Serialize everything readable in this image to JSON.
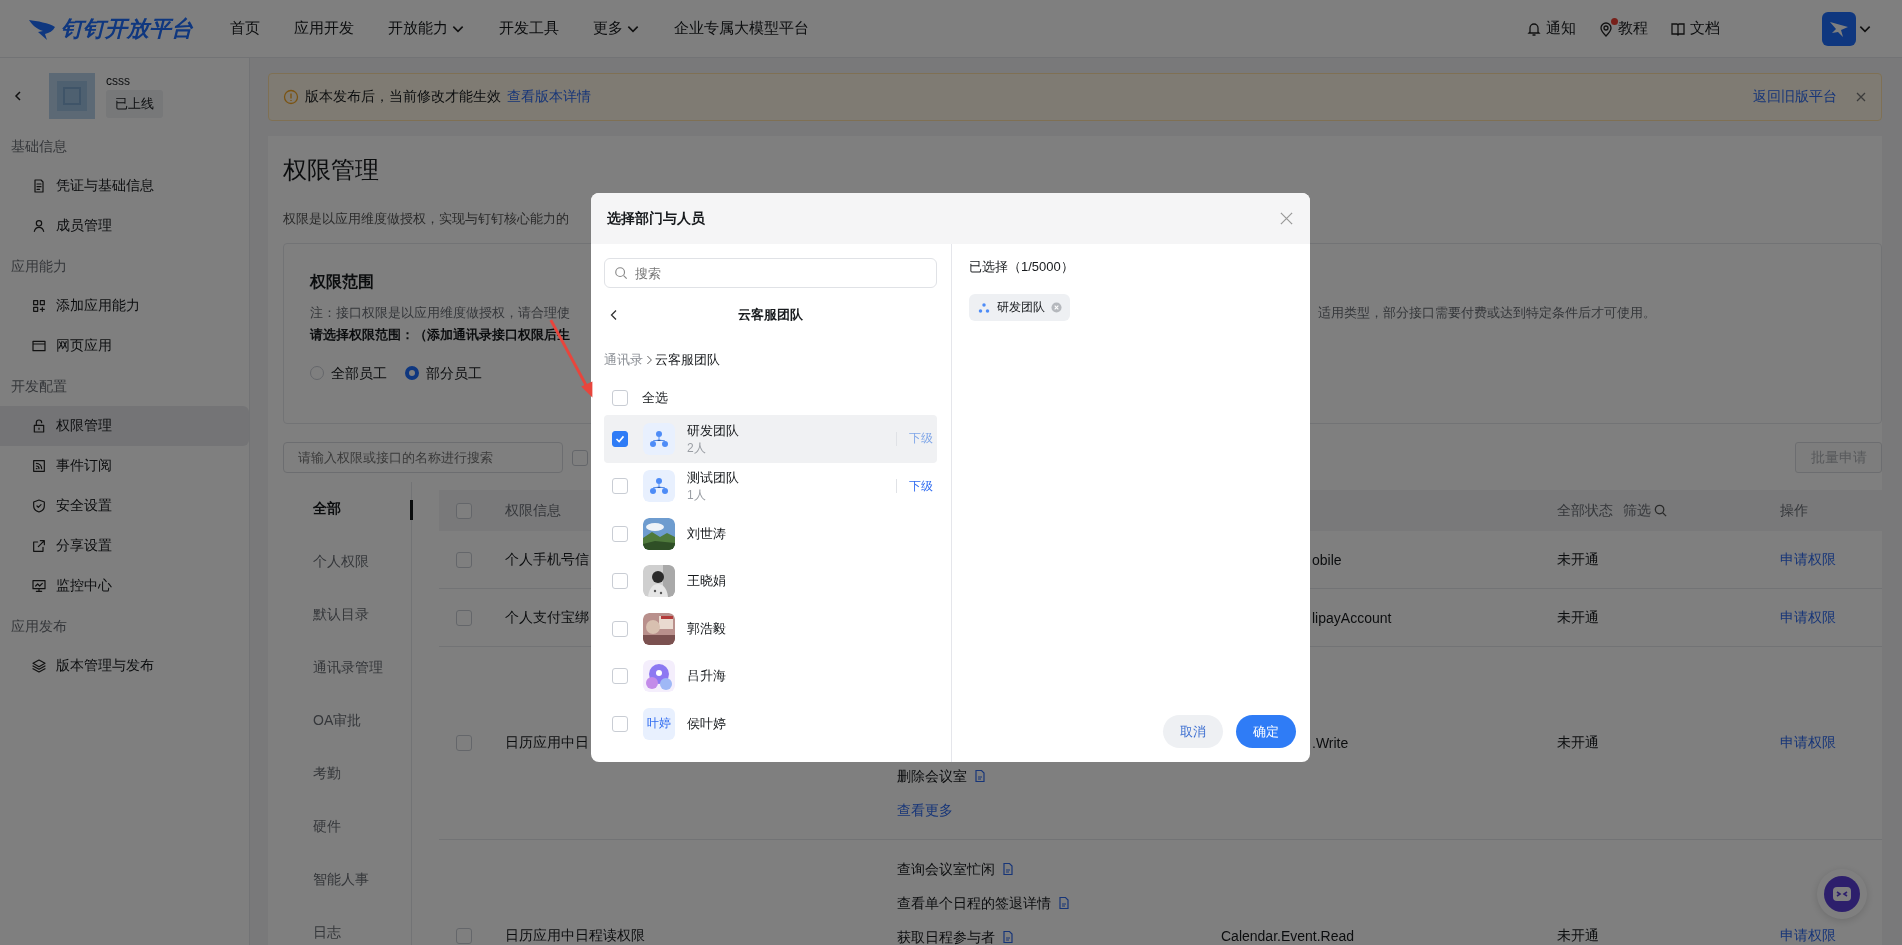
{
  "nav": {
    "logo": "钉钉开放平台",
    "menu": [
      {
        "label": "首页",
        "dropdown": false
      },
      {
        "label": "应用开发",
        "dropdown": false
      },
      {
        "label": "开放能力",
        "dropdown": true
      },
      {
        "label": "开发工具",
        "dropdown": false
      },
      {
        "label": "更多",
        "dropdown": true
      },
      {
        "label": "企业专属大模型平台",
        "dropdown": false
      }
    ],
    "links": [
      {
        "label": "通知",
        "badge": false
      },
      {
        "label": "教程",
        "badge": true
      },
      {
        "label": "文档",
        "badge": false
      }
    ]
  },
  "app": {
    "name": "csss",
    "status": "已上线"
  },
  "sidebar": [
    {
      "title": "基础信息",
      "items": [
        {
          "label": "凭证与基础信息",
          "selected": false
        },
        {
          "label": "成员管理",
          "selected": false
        }
      ]
    },
    {
      "title": "应用能力",
      "items": [
        {
          "label": "添加应用能力",
          "selected": false
        },
        {
          "label": "网页应用",
          "selected": false
        }
      ]
    },
    {
      "title": "开发配置",
      "items": [
        {
          "label": "权限管理",
          "selected": true
        },
        {
          "label": "事件订阅",
          "selected": false
        },
        {
          "label": "安全设置",
          "selected": false
        },
        {
          "label": "分享设置",
          "selected": false
        },
        {
          "label": "监控中心",
          "selected": false
        }
      ]
    },
    {
      "title": "应用发布",
      "items": [
        {
          "label": "版本管理与发布",
          "selected": false
        }
      ]
    }
  ],
  "banner": {
    "text": "版本发布后，当前修改才能生效",
    "link": "查看版本详情",
    "back_link": "返回旧版平台"
  },
  "page": {
    "title": "权限管理",
    "description": "权限是以应用维度做授权，实现与钉钉核心能力的"
  },
  "scope": {
    "title": "权限范围",
    "note_left": "注：接口权限是以应用维度做授权，请合理使",
    "note_right": "适用类型，部分接口需要付费或达到特定条件后才可使用。",
    "prompt": "请选择权限范围：（添加通讯录接口权限后生",
    "options": [
      {
        "label": "全部员工",
        "selected": false
      },
      {
        "label": "部分员工",
        "selected": true
      }
    ]
  },
  "search": {
    "placeholder": "请输入权限或接口的名称进行搜索"
  },
  "filter_checkbox": {
    "checked": false
  },
  "batch_button": "批量申请",
  "categories": [
    {
      "label": "全部",
      "selected": true
    },
    {
      "label": "个人权限",
      "selected": false
    },
    {
      "label": "默认目录",
      "selected": false
    },
    {
      "label": "通讯录管理",
      "selected": false
    },
    {
      "label": "OA审批",
      "selected": false
    },
    {
      "label": "考勤",
      "selected": false
    },
    {
      "label": "硬件",
      "selected": false
    },
    {
      "label": "智能人事",
      "selected": false
    },
    {
      "label": "日志",
      "selected": false
    }
  ],
  "table": {
    "columns": {
      "info": "权限信息",
      "status": "全部状态",
      "filter": "筛选",
      "action": "操作"
    },
    "header_checked": false,
    "rows": [
      {
        "checked": false,
        "info": "个人手机号信",
        "under_dialog": true,
        "api": "obile",
        "status": "未开通",
        "action": "申请权限"
      },
      {
        "checked": false,
        "info": "个人支付宝绑",
        "under_dialog": true,
        "api": "lipayAccount",
        "status": "未开通",
        "action": "申请权限"
      },
      {
        "checked": false,
        "info": "日历应用中日",
        "under_dialog": true,
        "names": [
          "删除会议室"
        ],
        "more": "查看更多",
        "api": ".Write",
        "status": "未开通",
        "action": "申请权限"
      },
      {
        "checked": false,
        "info": "日历应用中日程读权限",
        "names": [
          "查询会议室忙闲",
          "查看单个日程的签退详情",
          "获取日程参与者"
        ],
        "api": "Calendar.Event.Read",
        "status": "未开通",
        "action": "申请权限"
      }
    ]
  },
  "dialog": {
    "title": "选择部门与人员",
    "search_placeholder": "搜索",
    "folder": "云客服团队",
    "breadcrumb": [
      "通讯录",
      "云客服团队"
    ],
    "select_all": {
      "label": "全选",
      "checked": false
    },
    "items": [
      {
        "kind": "team",
        "name": "研发团队",
        "count": "2人",
        "checked": true,
        "selected": true,
        "sub_link": "下级",
        "sub_disabled": true
      },
      {
        "kind": "team",
        "name": "测试团队",
        "count": "1人",
        "checked": false,
        "selected": false,
        "sub_link": "下级",
        "sub_disabled": false
      },
      {
        "name": "刘世涛",
        "checked": false,
        "selected": false
      },
      {
        "name": "王晓娟",
        "checked": false,
        "selected": false
      },
      {
        "name": "郭浩毅",
        "checked": false,
        "selected": false
      },
      {
        "name": "吕升海",
        "checked": false,
        "selected": false
      },
      {
        "kind": "initials",
        "name": "侯叶婷",
        "initials": "叶婷",
        "checked": false,
        "selected": false
      }
    ],
    "selected_title": "已选择（1/5000）",
    "chips": [
      {
        "label": "研发团队"
      }
    ],
    "cancel": "取消",
    "ok": "确定"
  }
}
